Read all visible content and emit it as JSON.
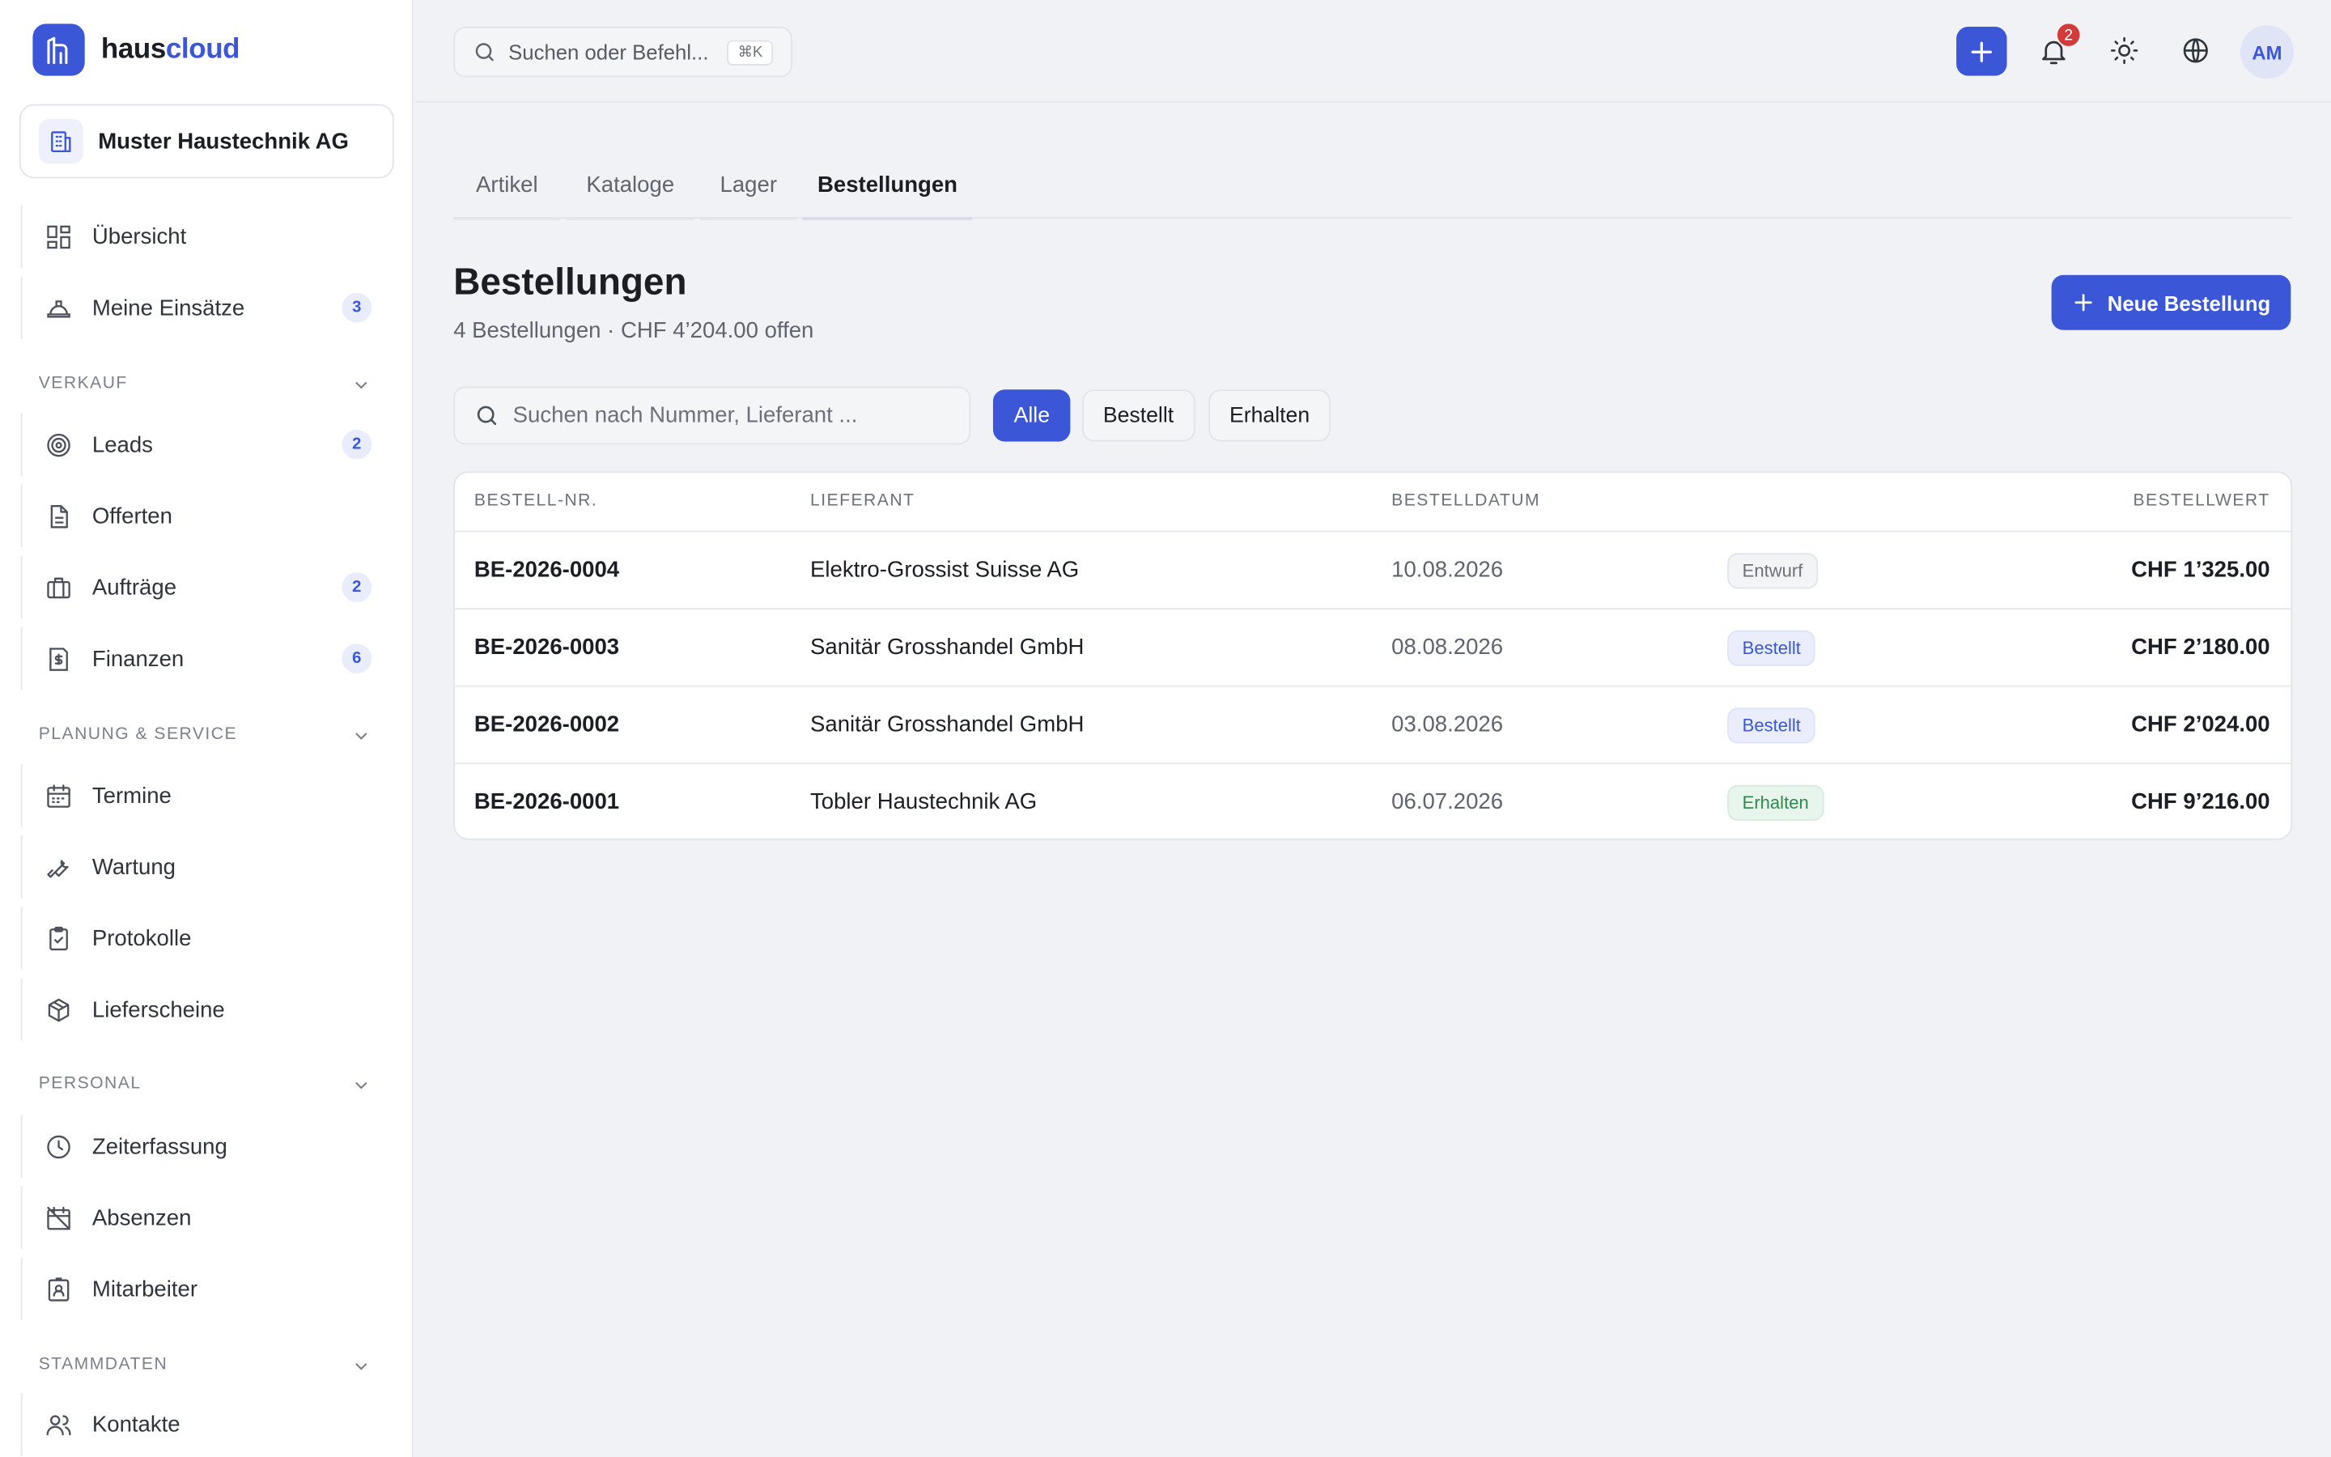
{
  "brand": {
    "part1": "haus",
    "part2": "cloud"
  },
  "company": {
    "name": "Muster Haustechnik AG"
  },
  "sidebar": {
    "top_items": [
      {
        "label": "Übersicht",
        "icon": "dashboard-icon"
      },
      {
        "label": "Meine Einsätze",
        "icon": "hard-hat-icon",
        "badge": "3"
      }
    ],
    "sections": [
      {
        "label": "Verkauf",
        "items": [
          {
            "label": "Leads",
            "icon": "target-icon",
            "badge": "2"
          },
          {
            "label": "Offerten",
            "icon": "document-icon"
          },
          {
            "label": "Aufträge",
            "icon": "briefcase-icon",
            "badge": "2"
          },
          {
            "label": "Finanzen",
            "icon": "invoice-icon",
            "badge": "6"
          }
        ]
      },
      {
        "label": "Planung & Service",
        "items": [
          {
            "label": "Termine",
            "icon": "calendar-icon"
          },
          {
            "label": "Wartung",
            "icon": "wrench-icon"
          },
          {
            "label": "Protokolle",
            "icon": "clipboard-check-icon"
          },
          {
            "label": "Lieferscheine",
            "icon": "package-icon"
          }
        ]
      },
      {
        "label": "Personal",
        "items": [
          {
            "label": "Zeiterfassung",
            "icon": "clock-icon"
          },
          {
            "label": "Absenzen",
            "icon": "calendar-off-icon"
          },
          {
            "label": "Mitarbeiter",
            "icon": "id-badge-icon"
          }
        ]
      },
      {
        "label": "Stammdaten",
        "items": [
          {
            "label": "Kontakte",
            "icon": "users-icon"
          }
        ]
      }
    ]
  },
  "topbar": {
    "search_placeholder": "Suchen oder Befehl...",
    "shortcut": "⌘K",
    "notifications_count": "2",
    "avatar_initials": "AM"
  },
  "tabs": [
    {
      "label": "Artikel",
      "active": false
    },
    {
      "label": "Kataloge",
      "active": false
    },
    {
      "label": "Lager",
      "active": false
    },
    {
      "label": "Bestellungen",
      "active": true
    }
  ],
  "page": {
    "title": "Bestellungen",
    "subtitle": "4 Bestellungen · CHF 4’204.00 offen",
    "new_button": "Neue Bestellung",
    "search_placeholder": "Suchen nach Nummer, Lieferant ...",
    "filters": [
      {
        "label": "Alle",
        "active": true
      },
      {
        "label": "Bestellt",
        "active": false
      },
      {
        "label": "Erhalten",
        "active": false
      }
    ]
  },
  "table": {
    "headers": {
      "number": "Bestell-Nr.",
      "supplier": "Lieferant",
      "date": "Bestelldatum",
      "value": "Bestellwert"
    },
    "rows": [
      {
        "number": "BE-2026-0004",
        "supplier": "Elektro-Grossist Suisse AG",
        "date": "10.08.2026",
        "status": "Entwurf",
        "status_kind": "entwurf",
        "value": "CHF 1’325.00"
      },
      {
        "number": "BE-2026-0003",
        "supplier": "Sanitär Grosshandel GmbH",
        "date": "08.08.2026",
        "status": "Bestellt",
        "status_kind": "bestellt",
        "value": "CHF 2’180.00"
      },
      {
        "number": "BE-2026-0002",
        "supplier": "Sanitär Grosshandel GmbH",
        "date": "03.08.2026",
        "status": "Bestellt",
        "status_kind": "bestellt",
        "value": "CHF 2’024.00"
      },
      {
        "number": "BE-2026-0001",
        "supplier": "Tobler Haustechnik AG",
        "date": "06.07.2026",
        "status": "Erhalten",
        "status_kind": "erhalten",
        "value": "CHF 9’216.00"
      }
    ]
  },
  "colors": {
    "accent": "#3b56d6",
    "badge_red": "#d33a3a",
    "success": "#2f8a4e"
  }
}
